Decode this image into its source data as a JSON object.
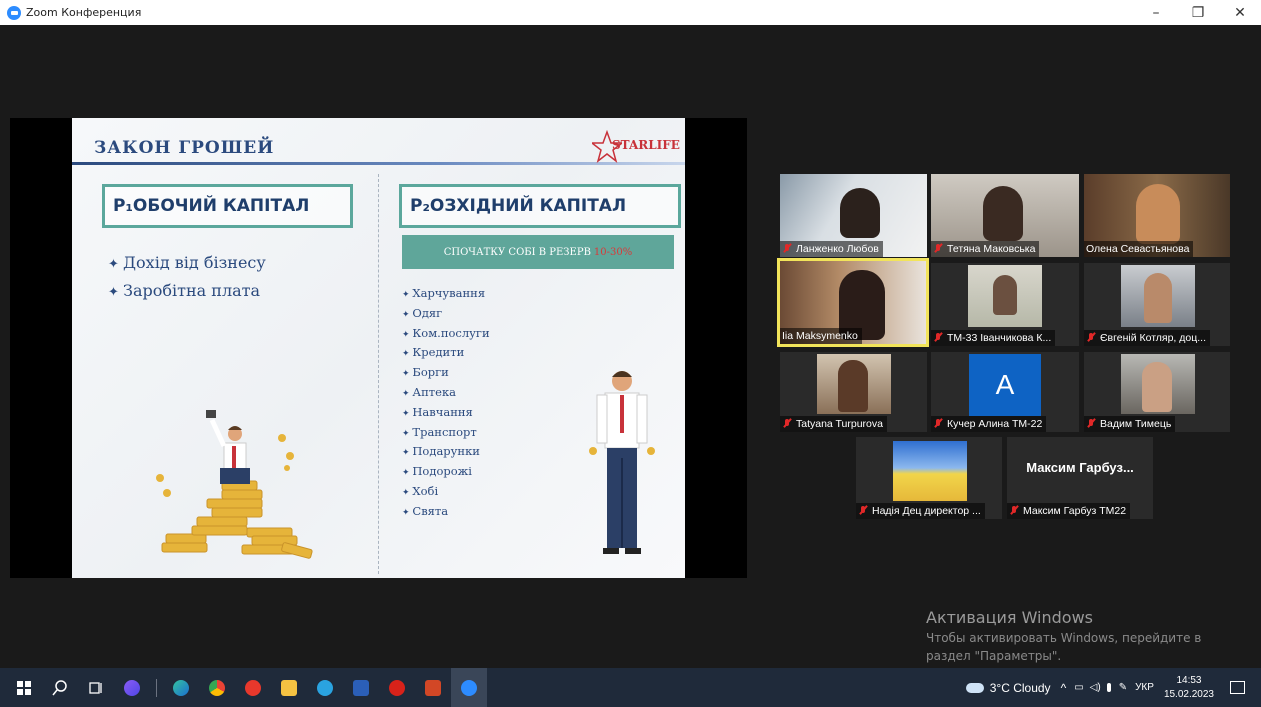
{
  "window": {
    "title": "Zoom Конференция",
    "minimize": "–",
    "restore": "❐",
    "close": "✕"
  },
  "slide": {
    "title": "ЗАКОН ГРОШЕЙ",
    "logo": "STARLIFE",
    "left_box": "Р₁ОБОЧИЙ КАПІТАЛ",
    "right_box": "Р₂ОЗХІДНИЙ КАПІТАЛ",
    "banner": "СПОЧАТКУ СОБІ В РЕЗЕРВ",
    "banner_highlight": "10-30%",
    "left_items": [
      "Дохід від бізнесу",
      "Заробітна плата"
    ],
    "right_items": [
      "Харчування",
      "Одяг",
      "Ком.послуги",
      "Кредити",
      "Борги",
      "Аптека",
      "Навчання",
      "Транспорт",
      "Подарунки",
      "Подорожі",
      "Хобі",
      "Свята"
    ]
  },
  "participants": [
    {
      "name": "Ланженко Любов",
      "muted": true
    },
    {
      "name": "Тетяна Маковська",
      "muted": true
    },
    {
      "name": "Олена Севастьянова",
      "muted": false
    },
    {
      "name": "Iia Maksymenko",
      "muted": false,
      "active": true
    },
    {
      "name": "ТМ-33 Іванчикова К...",
      "muted": true
    },
    {
      "name": "Євгеній Котляр, доц...",
      "muted": true
    },
    {
      "name": "Tatyana Turpurova",
      "muted": true
    },
    {
      "name": "Кучер Алина  ТМ-22",
      "muted": true,
      "avatar_letter": "A"
    },
    {
      "name": "Вадим Тимець",
      "muted": true
    },
    {
      "name": "Надія Дец директор ...",
      "muted": true
    },
    {
      "name": "Максим Гарбуз ТМ22",
      "muted": true,
      "display_name": "Максим  Гарбуз..."
    }
  ],
  "watermark": {
    "title": "Активация Windows",
    "text": "Чтобы активировать Windows, перейдите в раздел \"Параметры\"."
  },
  "taskbar": {
    "apps": [
      "start-icon",
      "search-icon",
      "task-view-icon",
      "alice-icon",
      "edge-icon",
      "chrome-icon",
      "yandex-icon",
      "file-explorer-icon",
      "telegram-icon",
      "word-icon",
      "opera-icon",
      "powerpoint-icon",
      "zoom-icon"
    ],
    "weather": "3°C  Cloudy",
    "language": "УКР",
    "time": "14:53",
    "date": "15.02.2023"
  }
}
